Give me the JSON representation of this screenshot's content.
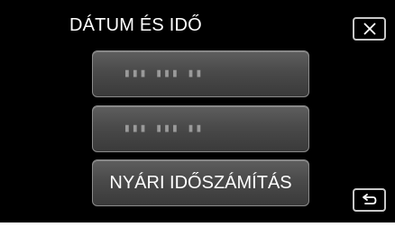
{
  "header": {
    "title": "DÁTUM ÉS IDŐ"
  },
  "icons": {
    "close": "close-icon",
    "back": "back-return-icon"
  },
  "settings": {
    "date_value": "▮▮▮ ▮▮▮ ▮▮",
    "time_value": "▮▮▮ ▮▮▮ ▮▮",
    "dst_label": "NYÁRI IDŐSZÁMÍTÁS"
  },
  "colors": {
    "background": "#000000",
    "button_face": "#4a4a4a",
    "text": "#ffffff",
    "placeholder_text": "#9a9a9a"
  }
}
